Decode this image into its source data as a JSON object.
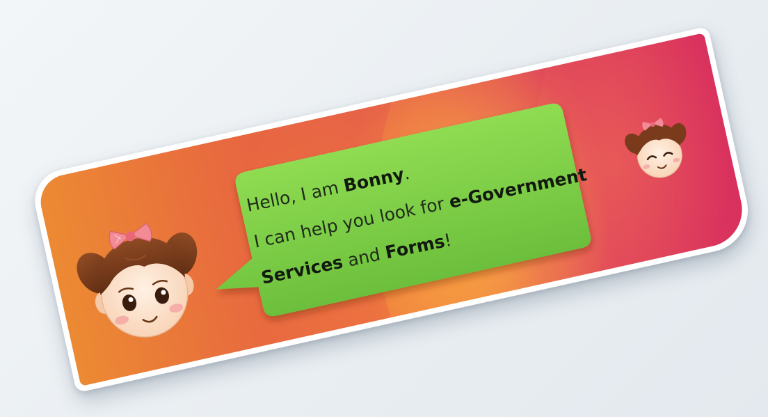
{
  "banner": {
    "line1": {
      "prefix": "Hello, I am ",
      "name": "Bonny",
      "suffix": "."
    },
    "line2": {
      "prefix": "I can help you look for ",
      "keyword": "e-Government"
    },
    "line3": {
      "keyword1": "Services",
      "middle": " and ",
      "keyword2": "Forms",
      "suffix": "!"
    }
  },
  "colors": {
    "bubble": "#7ed14a",
    "banner_start": "#ec8a33",
    "banner_end": "#d9305e",
    "bow": "#f07a8a",
    "hair": "#7a3b1c",
    "skin": "#fde0c8"
  },
  "icons": {
    "mascot_large": "girl-mascot-face",
    "mascot_small": "girl-mascot-smiling-face"
  }
}
